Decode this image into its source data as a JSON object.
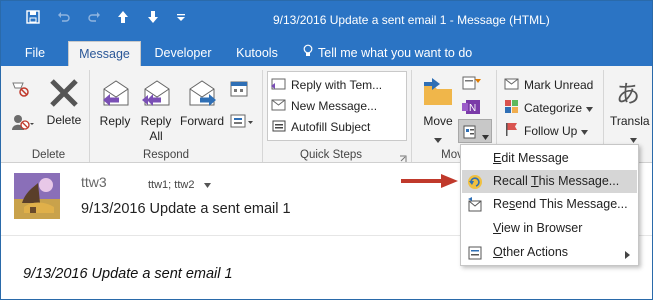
{
  "window": {
    "title": "9/13/2016 Update a sent email 1  -  Message (HTML)"
  },
  "quick_access": {
    "icons": [
      "save-icon",
      "undo-icon",
      "redo-icon",
      "up-arrow-icon",
      "down-arrow-icon",
      "customize-icon"
    ]
  },
  "tabs": [
    {
      "label": "File"
    },
    {
      "label": "Message"
    },
    {
      "label": "Developer"
    },
    {
      "label": "Kutools"
    },
    {
      "label": "Tell me what you want to do"
    }
  ],
  "ribbon": {
    "delete_group": {
      "label": "Delete",
      "delete_button": "Delete"
    },
    "respond_group": {
      "label": "Respond",
      "reply": "Reply",
      "reply_all_1": "Reply",
      "reply_all_2": "All",
      "forward": "Forward"
    },
    "quick_steps_group": {
      "label": "Quick Steps",
      "items": [
        "Reply with Tem...",
        "New Message...",
        "Autofill Subject"
      ]
    },
    "move_group": {
      "label": "Mov",
      "move_button": "Move"
    },
    "tags_group": {
      "mark_unread": "Mark Unread",
      "categorize": "Categorize",
      "follow_up": "Follow Up"
    },
    "translate": {
      "label": "Transla",
      "glyph": "あ"
    }
  },
  "message": {
    "from": "ttw3",
    "to": "ttw1; ttw2",
    "subject": "9/13/2016 Update a sent email 1",
    "body": "9/13/2016 Update a sent email 1"
  },
  "actions_menu": {
    "items": [
      {
        "label": "Edit Message",
        "u": "E",
        "rest": "dit Message"
      },
      {
        "label": "Recall This Message...",
        "pre": "Recall ",
        "u": "T",
        "rest": "his Message...",
        "highlighted": true
      },
      {
        "label": "Resend This Message...",
        "pre": "Re",
        "u": "s",
        "rest": "end This Message..."
      },
      {
        "label": "View in Browser",
        "u": "V",
        "rest": "iew in Browser"
      },
      {
        "label": "Other Actions",
        "u": "O",
        "rest": "ther Actions"
      }
    ]
  },
  "colors": {
    "title_bar": "#2b74c4",
    "ribbon": "#f3f3f3",
    "highlight": "#d6d6d6",
    "arrow": "#c0392b"
  }
}
